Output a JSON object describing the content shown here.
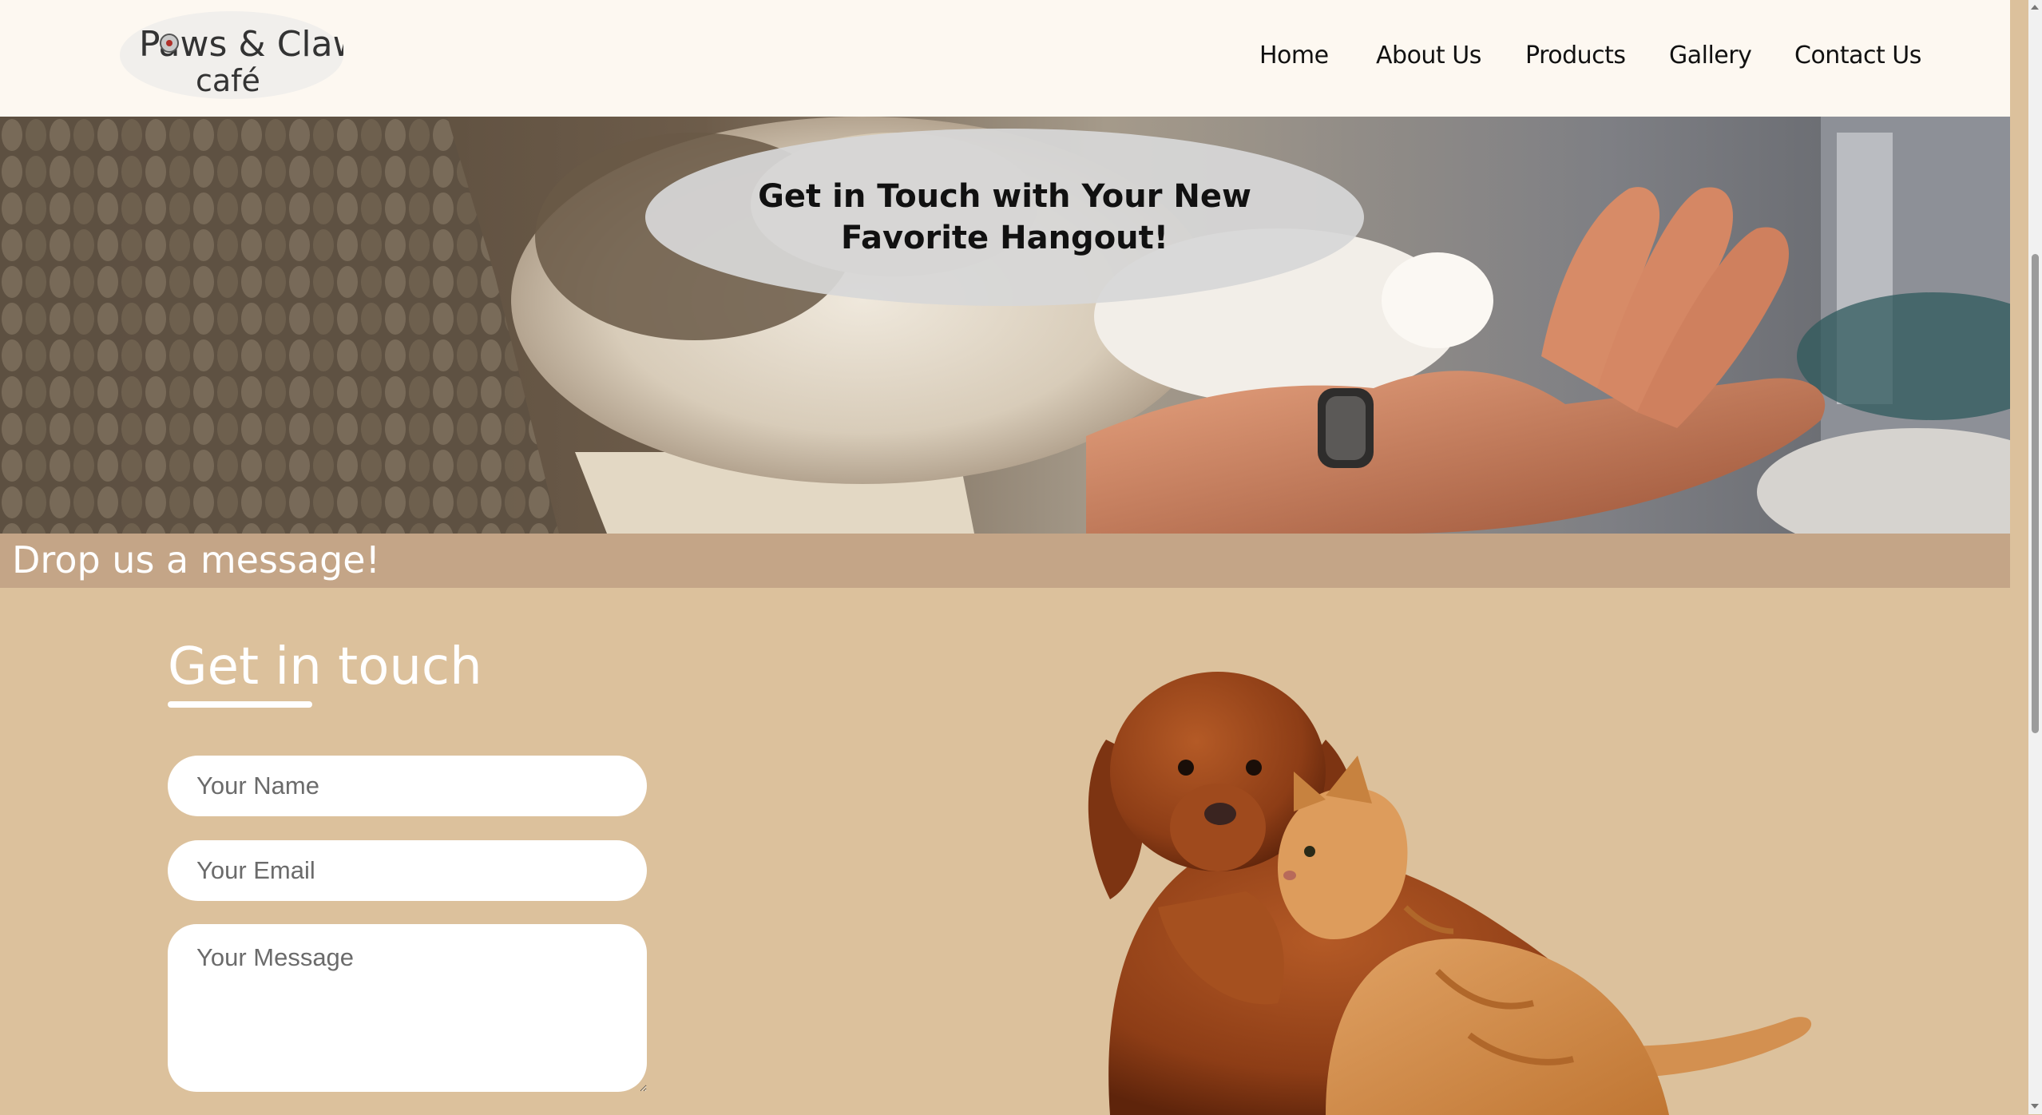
{
  "brand": {
    "logo_line1": "Paws & Claws",
    "logo_line2": "café"
  },
  "nav": {
    "items": [
      {
        "label": "Home"
      },
      {
        "label": "About Us"
      },
      {
        "label": "Products"
      },
      {
        "label": "Gallery"
      },
      {
        "label": "Contact Us"
      }
    ]
  },
  "hero": {
    "tagline": "Get in Touch with Your New Favorite Hangout!"
  },
  "banner": {
    "text": "Drop us a message!"
  },
  "contact": {
    "heading": "Get in touch",
    "name_placeholder": "Your Name",
    "email_placeholder": "Your Email",
    "message_placeholder": "Your Message"
  },
  "colors": {
    "header_bg": "#fdf8f1",
    "banner_bg": "#c4a587",
    "section_bg": "#dcc19c"
  }
}
